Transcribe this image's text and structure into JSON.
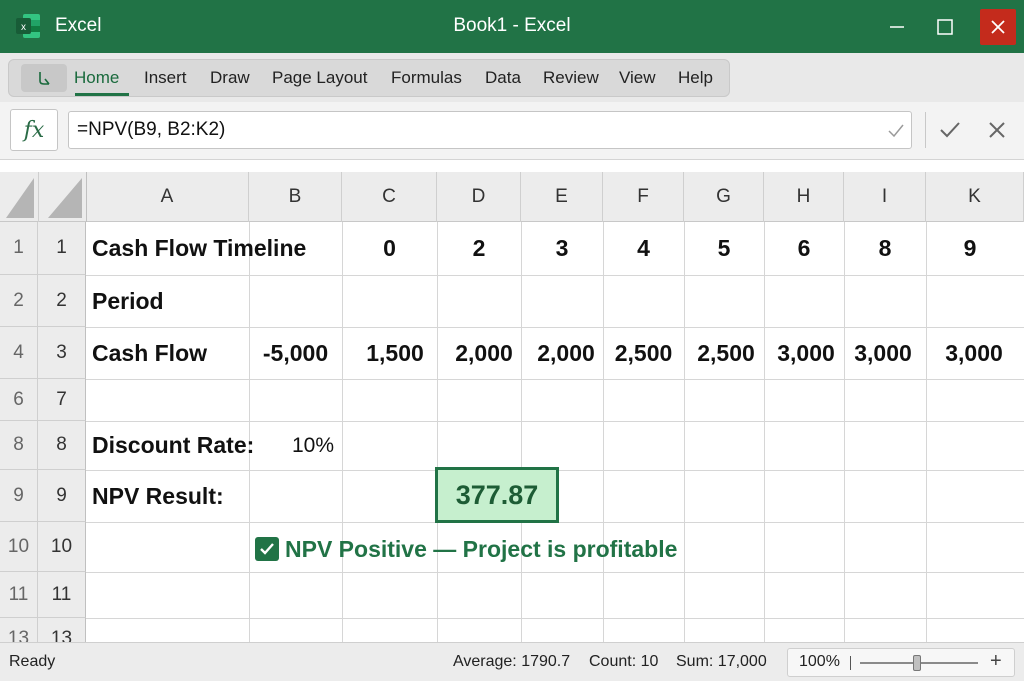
{
  "window": {
    "app_name": "Excel",
    "doc_title": "Book1 - Excel",
    "logo_letter": "x"
  },
  "colors": {
    "brand_green": "#217346",
    "close_red": "#c42b1c",
    "result_fill": "#c6efce"
  },
  "ribbon": {
    "tabs": [
      {
        "label": "Home",
        "active": true
      },
      {
        "label": "Insert"
      },
      {
        "label": "Draw"
      },
      {
        "label": "Page Layout"
      },
      {
        "label": "Formulas"
      },
      {
        "label": "Data"
      },
      {
        "label": "Review"
      },
      {
        "label": "View"
      },
      {
        "label": "Help"
      }
    ]
  },
  "formula_bar": {
    "fx_label": "fx",
    "formula": "=NPV(B9, B2:K2)"
  },
  "grid": {
    "columns": [
      "A",
      "B",
      "C",
      "D",
      "E",
      "F",
      "G",
      "H",
      "I",
      "K"
    ],
    "rows": [
      {
        "outer": "1",
        "inner": "1"
      },
      {
        "outer": "2",
        "inner": "2"
      },
      {
        "outer": "4",
        "inner": "3"
      },
      {
        "outer": "6",
        "inner": "7"
      },
      {
        "outer": "8",
        "inner": "8"
      },
      {
        "outer": "9",
        "inner": "9"
      },
      {
        "outer": "10",
        "inner": "10"
      },
      {
        "outer": "11",
        "inner": "11"
      },
      {
        "outer": "13",
        "inner": "13"
      }
    ],
    "timeline_label": "Cash Flow Timeline",
    "timeline_values": [
      "0",
      "2",
      "3",
      "4",
      "5",
      "6",
      "8",
      "9"
    ],
    "period_label": "Period",
    "cashflow_label": "Cash Flow",
    "cashflow_values": [
      "-5,000",
      "1,500",
      "2,000",
      "2,000",
      "2,500",
      "2,500",
      "3,000",
      "3,000",
      "3,000"
    ],
    "discount_label": "Discount Rate:",
    "discount_value": "10%",
    "npv_label": "NPV Result:",
    "npv_value": "377.87",
    "message": "NPV Positive — Project is profitable"
  },
  "status_bar": {
    "ready": "Ready",
    "average": "Average: 1790.7",
    "count": "Count: 10",
    "sum": "Sum: 17,000",
    "zoom": "100%"
  }
}
